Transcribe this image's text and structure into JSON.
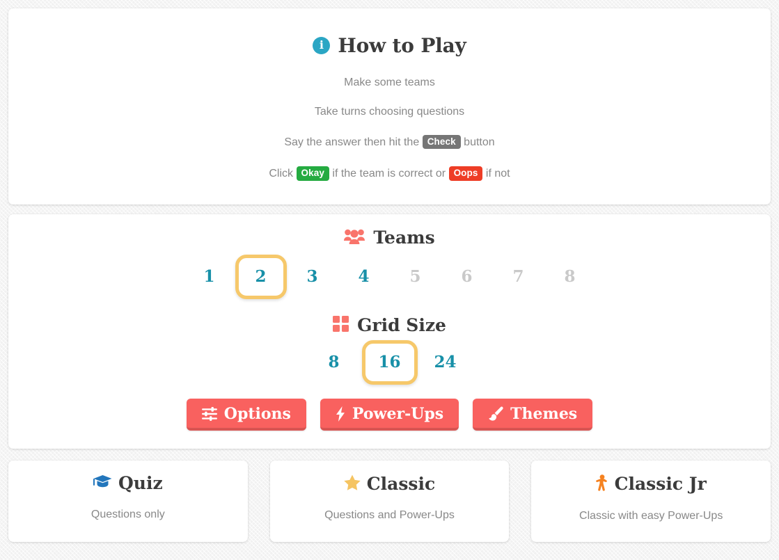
{
  "howto": {
    "title": "How to Play",
    "icon": "info-circle-icon",
    "lines": [
      {
        "pre": "Make some teams",
        "badge": null,
        "post": ""
      },
      {
        "pre": "Take turns choosing questions",
        "badge": null,
        "post": ""
      },
      {
        "pre": "Say the answer then hit the ",
        "badge": "Check",
        "post": " button"
      },
      {
        "pre": "Click ",
        "badge": "Okay",
        "mid": " if the team is correct or ",
        "badge2": "Oops",
        "post": " if not"
      }
    ],
    "line1": "Make some teams",
    "line2": "Take turns choosing questions",
    "line3_pre": "Say the answer then hit the",
    "line3_badge": "Check",
    "line3_post": "button",
    "line4_pre": "Click",
    "line4_badge_ok": "Okay",
    "line4_mid": "if the team is correct or",
    "line4_badge_bad": "Oops",
    "line4_post": "if not"
  },
  "teams": {
    "title": "Teams",
    "icon": "users-group-icon",
    "options": [
      {
        "label": "1",
        "selected": false,
        "disabled": false
      },
      {
        "label": "2",
        "selected": true,
        "disabled": false
      },
      {
        "label": "3",
        "selected": false,
        "disabled": false
      },
      {
        "label": "4",
        "selected": false,
        "disabled": false
      },
      {
        "label": "5",
        "selected": false,
        "disabled": true
      },
      {
        "label": "6",
        "selected": false,
        "disabled": true
      },
      {
        "label": "7",
        "selected": false,
        "disabled": true
      },
      {
        "label": "8",
        "selected": false,
        "disabled": true
      }
    ],
    "selected_value": "2"
  },
  "grid": {
    "title": "Grid Size",
    "icon": "grid-squares-icon",
    "options": [
      {
        "label": "8",
        "selected": false,
        "disabled": false
      },
      {
        "label": "16",
        "selected": true,
        "disabled": false
      },
      {
        "label": "24",
        "selected": false,
        "disabled": false
      }
    ],
    "selected_value": "16"
  },
  "setup_buttons": [
    {
      "label": "Options",
      "icon": "sliders-icon"
    },
    {
      "label": "Power-Ups",
      "icon": "lightning-bolt-icon"
    },
    {
      "label": "Themes",
      "icon": "paintbrush-icon"
    }
  ],
  "modes": [
    {
      "title": "Quiz",
      "desc": "Questions only",
      "icon": "graduation-cap-icon",
      "icon_color": "#2276bc"
    },
    {
      "title": "Classic",
      "desc": "Questions and Power-Ups",
      "icon": "star-icon",
      "icon_color": "#f5c462"
    },
    {
      "title": "Classic Jr",
      "desc": "Classic with easy Power-Ups",
      "icon": "child-icon",
      "icon_color": "#f58220"
    }
  ],
  "colors": {
    "accent_coral": "#f9615f",
    "accent_teal": "#1890a8",
    "accent_gold": "#f6c86a",
    "badge_gray": "#767676",
    "badge_green": "#25ab41",
    "badge_red": "#ee3d26",
    "info_blue": "#2ba6c4",
    "text_dark": "#3b3b3b",
    "text_muted": "#888888",
    "page_bg": "#f1f1f1"
  }
}
